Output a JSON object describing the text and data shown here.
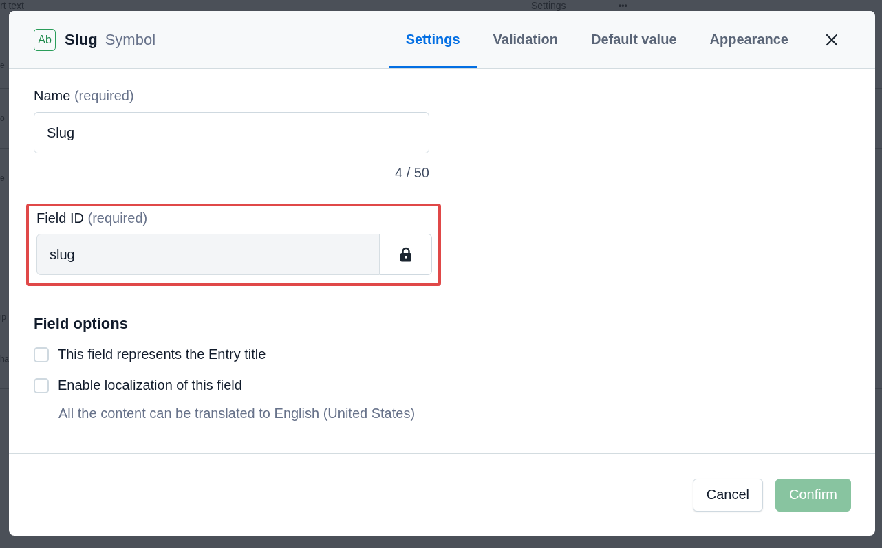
{
  "background": {
    "header_texts": [
      "rt text",
      "Settings",
      "•••"
    ],
    "row_fragments": [
      "e",
      "o",
      "e",
      "ip",
      "ha"
    ]
  },
  "dialog": {
    "type_badge": "Ab",
    "title": "Slug",
    "subtitle": "Symbol",
    "tabs": [
      {
        "label": "Settings",
        "selected": true
      },
      {
        "label": "Validation",
        "selected": false
      },
      {
        "label": "Default value",
        "selected": false
      },
      {
        "label": "Appearance",
        "selected": false
      }
    ],
    "name_field": {
      "label": "Name",
      "hint": "(required)",
      "value": "Slug",
      "counter": "4 / 50"
    },
    "id_field": {
      "label": "Field ID",
      "hint": "(required)",
      "value": "slug",
      "disabled": true,
      "highlighted": true,
      "locked": true
    },
    "options_heading": "Field options",
    "options": [
      {
        "label": "This field represents the Entry title",
        "checked": false
      },
      {
        "label": "Enable localization of this field",
        "checked": false,
        "help": "All the content can be translated to English (United States)"
      }
    ],
    "buttons": [
      {
        "label": "Cancel",
        "kind": "secondary",
        "disabled": false
      },
      {
        "label": "Confirm",
        "kind": "primary",
        "disabled": true
      }
    ]
  }
}
